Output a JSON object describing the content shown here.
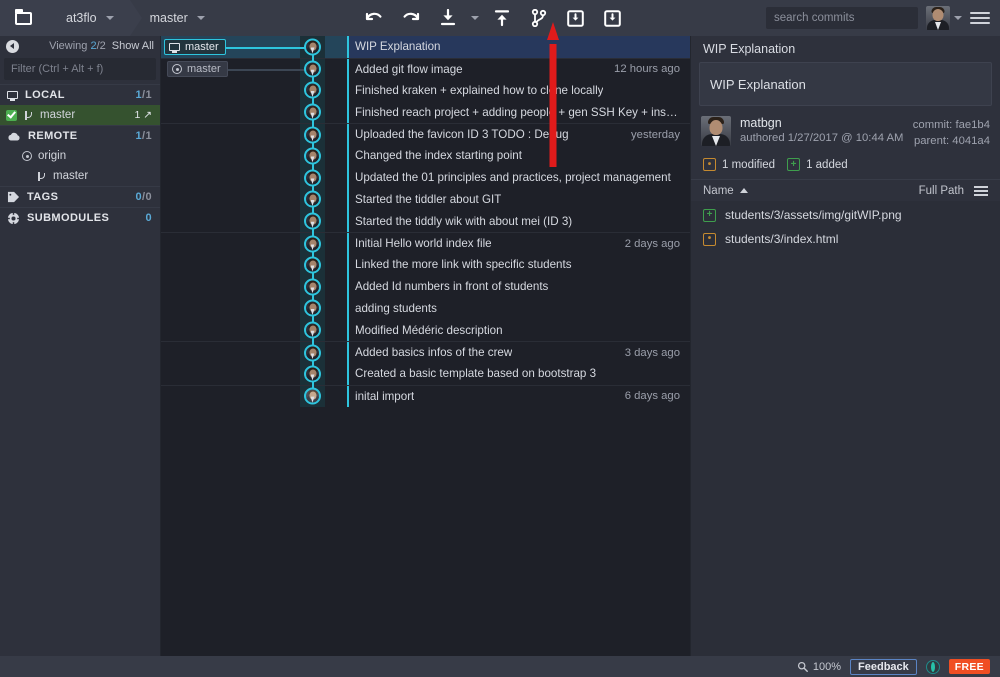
{
  "topbar": {
    "folder_icon": "folder-icon",
    "repo": "at3flo",
    "branch": "master",
    "tools": [
      {
        "name": "undo-button",
        "icon": "undo-icon"
      },
      {
        "name": "redo-button",
        "icon": "redo-icon"
      },
      {
        "name": "pull-button",
        "icon": "pull-down-icon"
      },
      {
        "name": "pull-dropdown",
        "icon": "chevron-down-icon"
      },
      {
        "name": "push-button",
        "icon": "push-up-icon"
      },
      {
        "name": "branch-button",
        "icon": "branch-icon"
      },
      {
        "name": "stash-button",
        "icon": "stash-icon"
      },
      {
        "name": "pop-stash-button",
        "icon": "pop-stash-icon"
      }
    ],
    "search_placeholder": "search commits",
    "search_value": "",
    "search_icon": "search-icon",
    "avatar": "user-avatar",
    "menu_icon": "hamburger-menu-icon"
  },
  "sidebar": {
    "collapse_icon": "collapse-left-icon",
    "viewing_label": "Viewing",
    "viewing_current": "2",
    "viewing_total": "/2",
    "show_all": "Show All",
    "filter_placeholder": "Filter (Ctrl + Alt + f)",
    "filter_value": "",
    "sections": [
      {
        "name": "LOCAL",
        "count_active": "1",
        "count_total": "/1",
        "icon": "monitor-icon",
        "items": [
          {
            "label": "master",
            "checked": true,
            "icon": "branch-icon",
            "after": "1 ↗",
            "selected": true
          }
        ]
      },
      {
        "name": "REMOTE",
        "count_active": "1",
        "count_total": "/1",
        "icon": "cloud-icon",
        "items": [
          {
            "label": "origin",
            "icon": "remote-circle-icon",
            "indent": 1
          },
          {
            "label": "master",
            "icon": "branch-icon",
            "indent": 2
          }
        ]
      },
      {
        "name": "TAGS",
        "count_active": "0",
        "count_total": "/0",
        "icon": "tag-icon",
        "items": []
      },
      {
        "name": "SUBMODULES",
        "count_active": "0",
        "count_total": "",
        "icon": "submodule-icon",
        "items": []
      }
    ]
  },
  "graph": {
    "ref_local": "master",
    "ref_remote": "master",
    "commits": [
      {
        "message": "WIP Explanation",
        "time": "",
        "selected": true,
        "separator": false
      },
      {
        "message": "Added git flow image",
        "time": "12 hours ago",
        "separator": true
      },
      {
        "message": "Finished kraken + explained how to clone locally",
        "time": "",
        "separator": false
      },
      {
        "message": "Finished reach project + adding people + gen SSH Key + install kraken",
        "time": "",
        "separator": false
      },
      {
        "message": "Uploaded the favicon ID 3 TODO : Debug",
        "time": "yesterday",
        "separator": true
      },
      {
        "message": "Changed the index starting point",
        "time": "",
        "separator": false
      },
      {
        "message": "Updated the 01 principles and practices, project management",
        "time": "",
        "separator": false
      },
      {
        "message": "Started the tiddler about GIT",
        "time": "",
        "separator": false
      },
      {
        "message": "Started the tiddly wik with about mei (ID 3)",
        "time": "",
        "separator": false
      },
      {
        "message": "Initial Hello world index file",
        "time": "2 days ago",
        "separator": true
      },
      {
        "message": "Linked the more link with specific students",
        "time": "",
        "separator": false
      },
      {
        "message": "Added Id numbers in front of students",
        "time": "",
        "separator": false
      },
      {
        "message": "adding students",
        "time": "",
        "separator": false
      },
      {
        "message": "Modified Médéric description",
        "time": "",
        "separator": false
      },
      {
        "message": "Added basics infos of the crew",
        "time": "3 days ago",
        "separator": true
      },
      {
        "message": "Created a basic template based on bootstrap 3",
        "time": "",
        "separator": false
      },
      {
        "message": "inital import",
        "time": "6 days ago",
        "separator": true
      }
    ]
  },
  "detail": {
    "panel_title": "WIP Explanation",
    "commit_message": "WIP Explanation",
    "author": "matbgn",
    "authored": "authored 1/27/2017 @ 10:44 AM",
    "commit_hash_label": "commit: fae1b4",
    "parent_hash_label": "parent: 4041a4",
    "stats": [
      {
        "label": "1 modified",
        "icon": "modified-icon",
        "glyph": "•••",
        "color": "#c58a30"
      },
      {
        "label": "1 added",
        "icon": "added-icon",
        "glyph": "+",
        "color": "#3f9e4d"
      }
    ],
    "col_name": "Name",
    "col_fullpath": "Full Path",
    "list_view_icon": "list-view-icon",
    "files": [
      {
        "path": "students/3/assets/img/gitWIP.png",
        "status": "added",
        "glyph": "+",
        "color": "#3f9e4d"
      },
      {
        "path": "students/3/index.html",
        "status": "modified",
        "glyph": "•••",
        "color": "#c58a30"
      }
    ]
  },
  "status": {
    "zoom_icon": "magnifier-icon",
    "zoom": "100%",
    "feedback": "Feedback",
    "globe_icon": "globe-icon",
    "plan": "FREE"
  },
  "annotation": {
    "arrow": "red-up-arrow pointing at push button"
  },
  "colors": {
    "accent": "#2ec5de",
    "selected_row": "#27385c",
    "branch_green": "#35522f",
    "free_badge": "#f04e23"
  }
}
